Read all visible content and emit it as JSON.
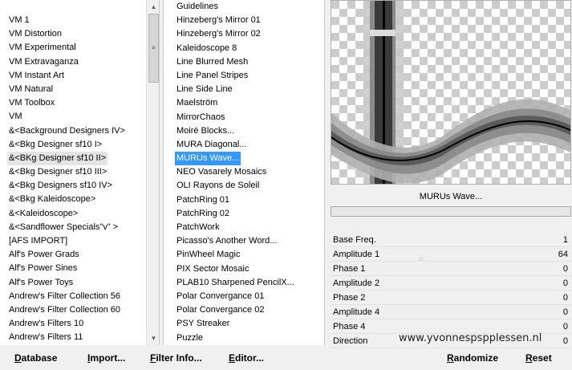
{
  "left_list": {
    "items": [
      "VM 1",
      "VM Distortion",
      "VM Experimental",
      "VM Extravaganza",
      "VM Instant Art",
      "VM Natural",
      "VM Toolbox",
      "VM",
      "&<Background Designers IV>",
      "&<Bkg Designer sf10 I>",
      "&<BKg Designer sf10 II>",
      "&<Bkg Designer sf10 III>",
      "&<Bkg Designers sf10 IV>",
      "&<Bkg Kaleidoscope>",
      "&<Kaleidoscope>",
      "&<Sandflower Specials\"v\" >",
      "[AFS IMPORT]",
      "Alf's Power Grads",
      "Alf's Power Sines",
      "Alf's Power Toys",
      "Andrew's Filter Collection 56",
      "Andrew's Filter Collection 60",
      "Andrew's Filters 10",
      "Andrew's Filters 11"
    ],
    "selected_index": 10
  },
  "mid_list": {
    "items": [
      "Guidelines",
      "Hinzeberg's Mirror 01",
      "Hinzeberg's Mirror 02",
      "Kaleidoscope 8",
      "Line Blurred Mesh",
      "Line Panel Stripes",
      "Line Side Line",
      "Maelström",
      "MirrorChaos",
      "Moiré Blocks...",
      "MURA Diagonal...",
      "MURUs Wave...",
      "NEO Vasarely Mosaics",
      "OLI Rayons de Soleil",
      "PatchRing 01",
      "PatchRing 02",
      "PatchWork",
      "Picasso's Another Word...",
      "PinWheel Magic",
      "PIX Sector Mosaic",
      "PLAB10 Sharpened PencilX...",
      "Polar Convergance 01",
      "Polar Convergance 02",
      "PSY Streaker",
      "Puzzle"
    ],
    "selected_index": 11
  },
  "preview": {
    "filter_name": "MURUs Wave..."
  },
  "params": [
    {
      "name": "Base Freq.",
      "value": "1"
    },
    {
      "name": "Amplitude 1",
      "value": "64",
      "slider_fraction": 0.25
    },
    {
      "name": "Phase 1",
      "value": "0"
    },
    {
      "name": "Amplitude 2",
      "value": "0"
    },
    {
      "name": "Phase 2",
      "value": "0"
    },
    {
      "name": "Amplitude 4",
      "value": "0"
    },
    {
      "name": "Phase 4",
      "value": "0"
    },
    {
      "name": "Direction",
      "value": "0"
    }
  ],
  "watermark": "www.yvonnespspplessen.nl",
  "buttons": {
    "database": {
      "u": "D",
      "rest": "atabase"
    },
    "import": {
      "u": "I",
      "rest": "mport..."
    },
    "filterinfo": {
      "u": "F",
      "rest": "ilter Info..."
    },
    "editor": {
      "u": "E",
      "rest": "ditor..."
    },
    "randomize": {
      "u": "R",
      "rest": "andomize"
    },
    "reset": {
      "u": "R",
      "rest": "eset"
    }
  },
  "colors": {
    "selection_blue": "#3399ff",
    "selection_grey": "#e4e4e4"
  }
}
